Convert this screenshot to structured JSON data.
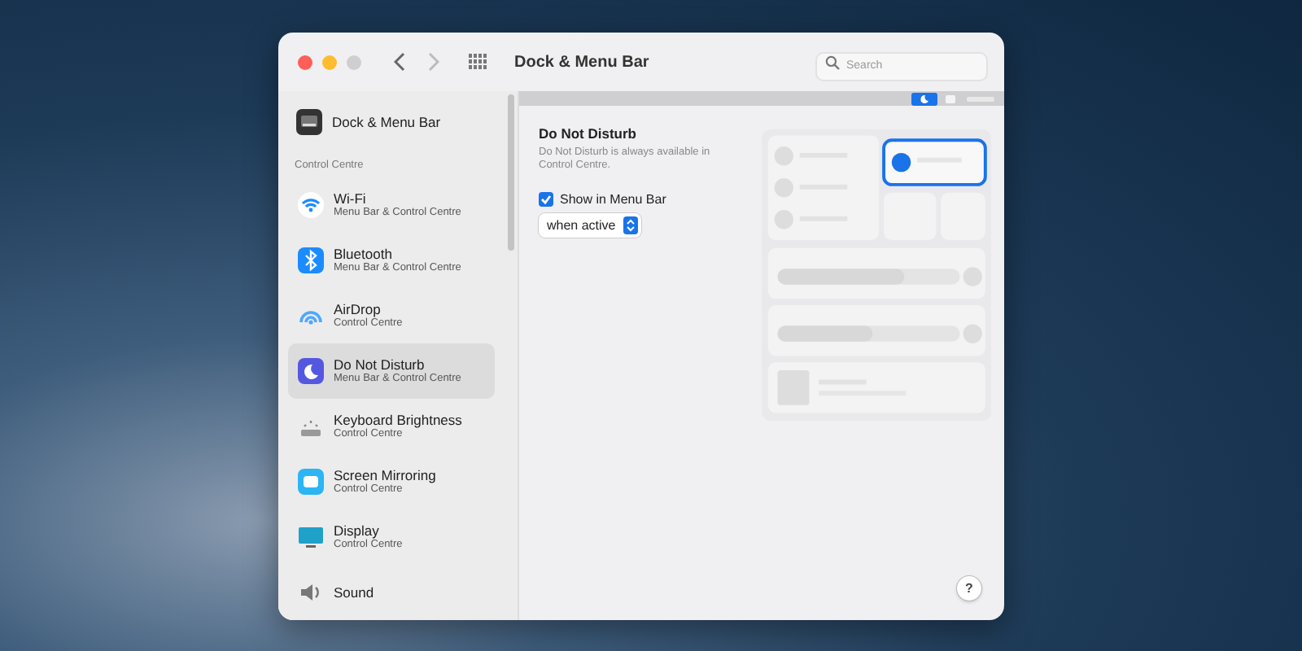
{
  "window": {
    "title": "Dock & Menu Bar",
    "search": {
      "placeholder": "Search"
    }
  },
  "sidebar": {
    "top_item": {
      "label": "Dock & Menu Bar",
      "selected": false
    },
    "section": "Control Centre",
    "items": [
      {
        "kind": "wifi",
        "label": "Wi-Fi",
        "sublabel": "Menu Bar & Control Centre",
        "selected": false
      },
      {
        "kind": "bluetooth",
        "label": "Bluetooth",
        "sublabel": "Menu Bar & Control Centre",
        "selected": false
      },
      {
        "kind": "airdrop",
        "label": "AirDrop",
        "sublabel": "Control Centre",
        "selected": false
      },
      {
        "kind": "moon",
        "label": "Do Not Disturb",
        "sublabel": "Menu Bar & Control Centre",
        "selected": true
      },
      {
        "kind": "keyboard",
        "label": "Keyboard Brightness",
        "sublabel": "Control Centre",
        "selected": false
      },
      {
        "kind": "mirroring",
        "label": "Screen Mirroring",
        "sublabel": "Control Centre",
        "selected": false
      },
      {
        "kind": "display",
        "label": "Display",
        "sublabel": "Control Centre",
        "selected": false
      },
      {
        "kind": "sound",
        "label": "Sound",
        "selected": false
      }
    ]
  },
  "detail": {
    "title": "Do Not Disturb",
    "description": "Do Not Disturb is always available in Control Centre.",
    "show_in_menu_bar": {
      "label": "Show in Menu Bar",
      "checked": true
    },
    "popup": {
      "value": "when active"
    }
  },
  "help": "?"
}
